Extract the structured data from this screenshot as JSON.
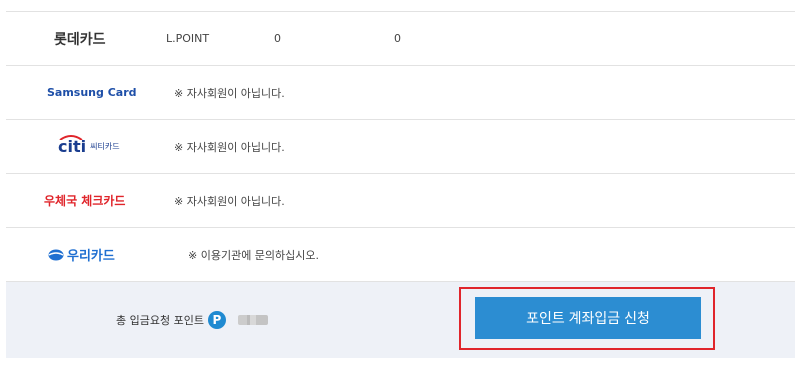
{
  "rows": [
    {
      "card": "롯데카드",
      "type": "L.POINT",
      "v1": "0",
      "v2": "0"
    },
    {
      "card": "Samsung Card",
      "note": "※ 자사회원이 아닙니다."
    },
    {
      "card_main": "citi",
      "card_sub": "씨티카드",
      "note": "※ 자사회원이 아닙니다."
    },
    {
      "card": "우체국 체크카드",
      "note": "※ 자사회원이 아닙니다."
    },
    {
      "card": "우리카드",
      "note": "※ 이용기관에 문의하십시오."
    }
  ],
  "summary": {
    "label": "총 입금요청 포인트",
    "badge": "P",
    "button": "포인트 계좌입금 신청"
  },
  "colors": {
    "accent": "#2c8dd2",
    "highlight_box": "#e0252b",
    "summary_bg": "#eef1f7",
    "samsung": "#1e4fa8",
    "citi": "#1a3d8f",
    "citi_arc": "#e0252b",
    "post": "#e0252b",
    "woori": "#1f6fd1"
  }
}
